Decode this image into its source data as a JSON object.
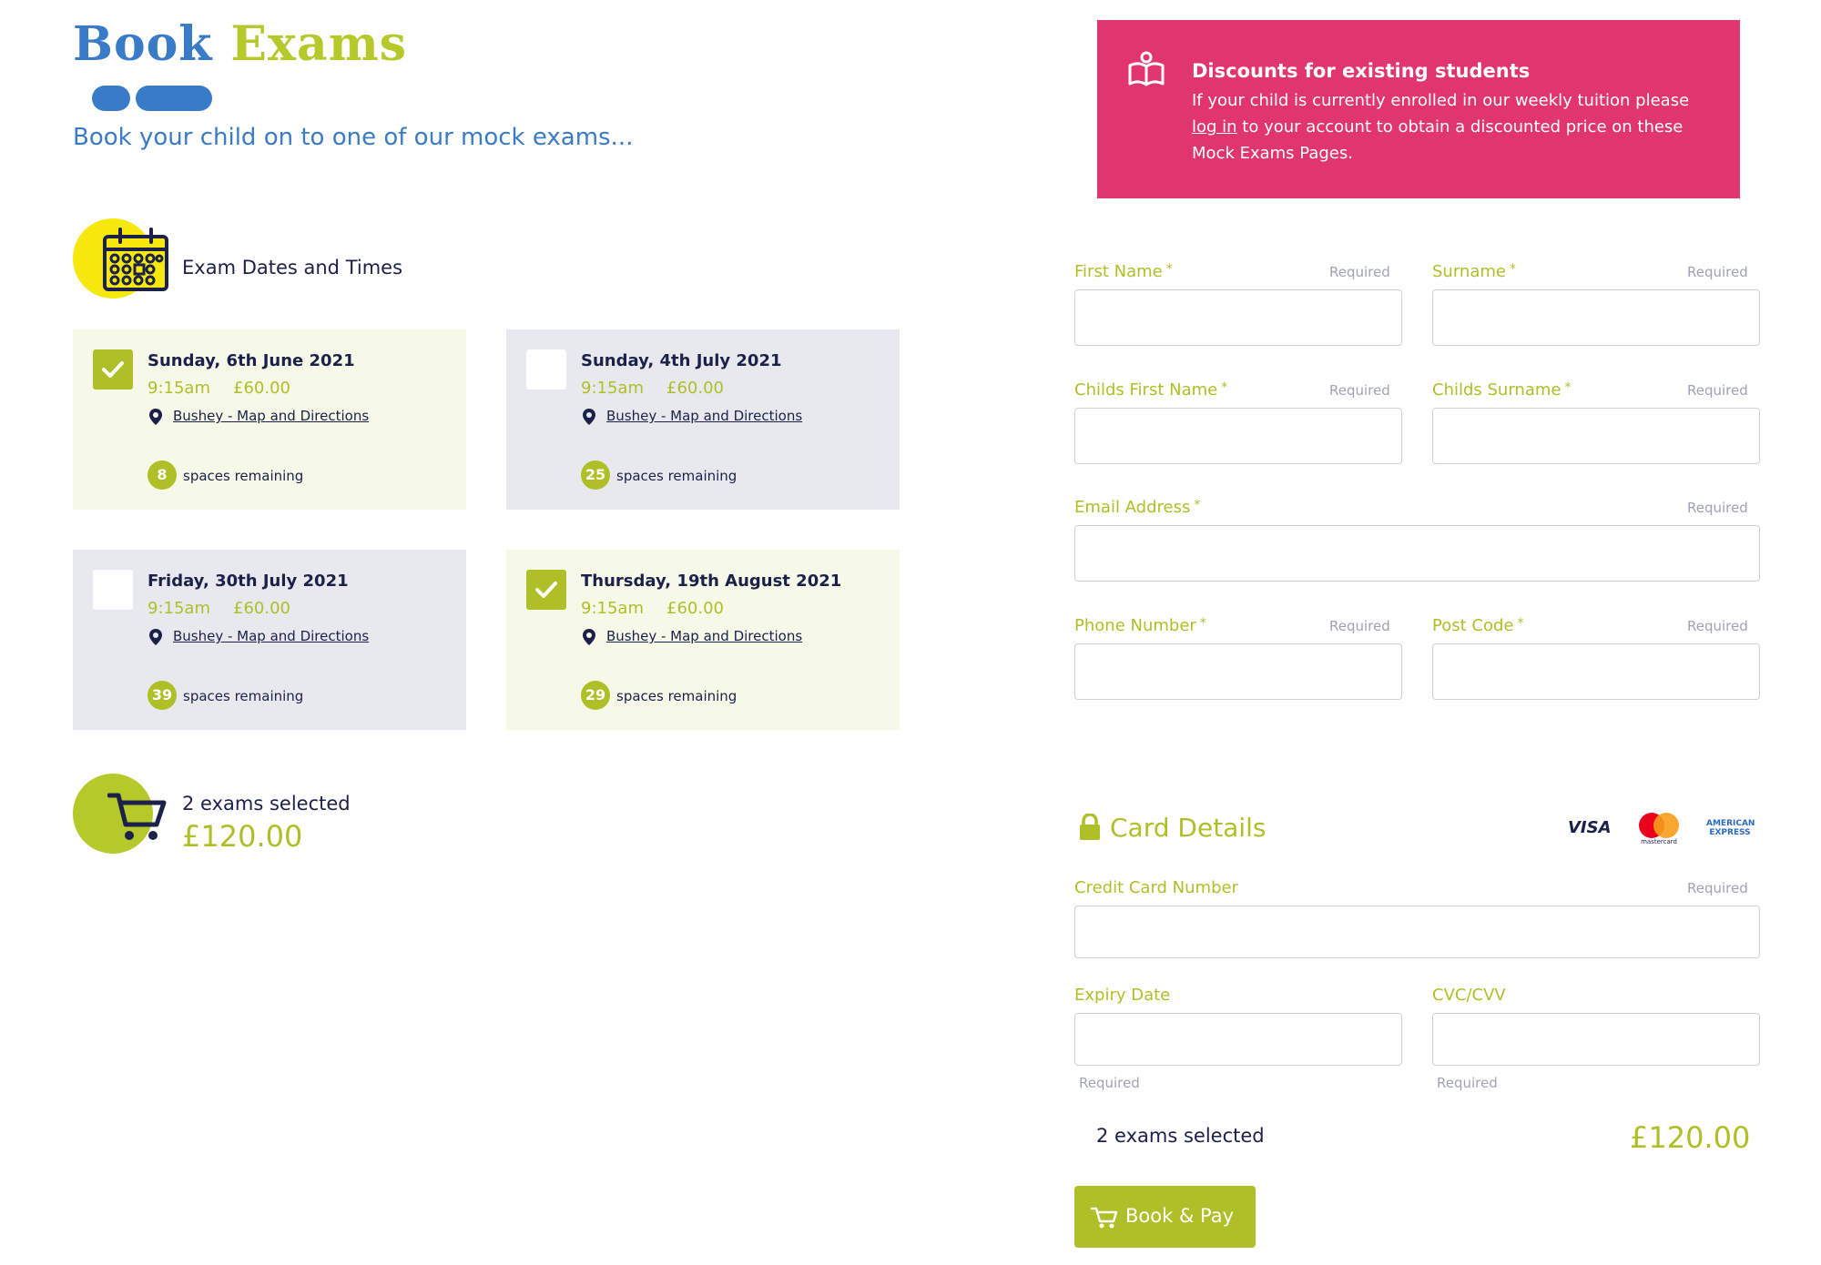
{
  "header": {
    "title_word1": "Book",
    "title_word2": "Exams",
    "subtitle": "Book your child on to one of our mock exams..."
  },
  "exams_section": {
    "heading": "Exam Dates and Times",
    "icon": "calendar-icon",
    "cards": [
      {
        "date": "Sunday, 6th June 2021",
        "time": "9:15am",
        "price": "£60.00",
        "location": "Bushey - Map and Directions",
        "spaces": "8",
        "spaces_label": "spaces remaining",
        "selected": true
      },
      {
        "date": "Sunday, 4th July 2021",
        "time": "9:15am",
        "price": "£60.00",
        "location": "Bushey - Map and Directions",
        "spaces": "25",
        "spaces_label": "spaces remaining",
        "selected": false
      },
      {
        "date": "Friday, 30th July 2021",
        "time": "9:15am",
        "price": "£60.00",
        "location": "Bushey - Map and Directions",
        "spaces": "39",
        "spaces_label": "spaces remaining",
        "selected": false
      },
      {
        "date": "Thursday, 19th August 2021",
        "time": "9:15am",
        "price": "£60.00",
        "location": "Bushey - Map and Directions",
        "spaces": "29",
        "spaces_label": "spaces remaining",
        "selected": true
      }
    ]
  },
  "cart_summary": {
    "icon": "cart-icon",
    "count_text": "2 exams selected",
    "total": "£120.00"
  },
  "discount_banner": {
    "icon": "open-book-icon",
    "title": "Discounts for existing students",
    "body_before_link": "If your child is currently enrolled in our weekly tuition please ",
    "link_text": "log in",
    "body_after_link": " to your account to obtain a discounted price on these Mock Exams Pages."
  },
  "form": {
    "required_text": "Required",
    "required_marker": "*",
    "first_name_label": "First Name",
    "surname_label": "Surname",
    "childs_first_name_label": "Childs First Name",
    "childs_surname_label": "Childs Surname",
    "email_label": "Email Address",
    "phone_label": "Phone Number",
    "postcode_label": "Post Code"
  },
  "card_details": {
    "heading": "Card Details",
    "lock_icon": "lock-icon",
    "brands": {
      "visa": "VISA",
      "mastercard": "mastercard",
      "amex_line1": "AMERICAN",
      "amex_line2": "EXPRESS"
    },
    "card_number_label": "Credit Card Number",
    "expiry_label": "Expiry Date",
    "cvc_label": "CVC/CVV"
  },
  "order_summary": {
    "count_text": "2 exams selected",
    "total": "£120.00"
  },
  "pay_button": {
    "label": "Book & Pay",
    "icon": "cart-icon"
  },
  "colors": {
    "brand_blue": "#3a7bc8",
    "brand_green": "#aebf27",
    "banner_pink": "#e0356e",
    "highlight_yellow": "#f6e80c",
    "navy_text": "#1b2149"
  }
}
